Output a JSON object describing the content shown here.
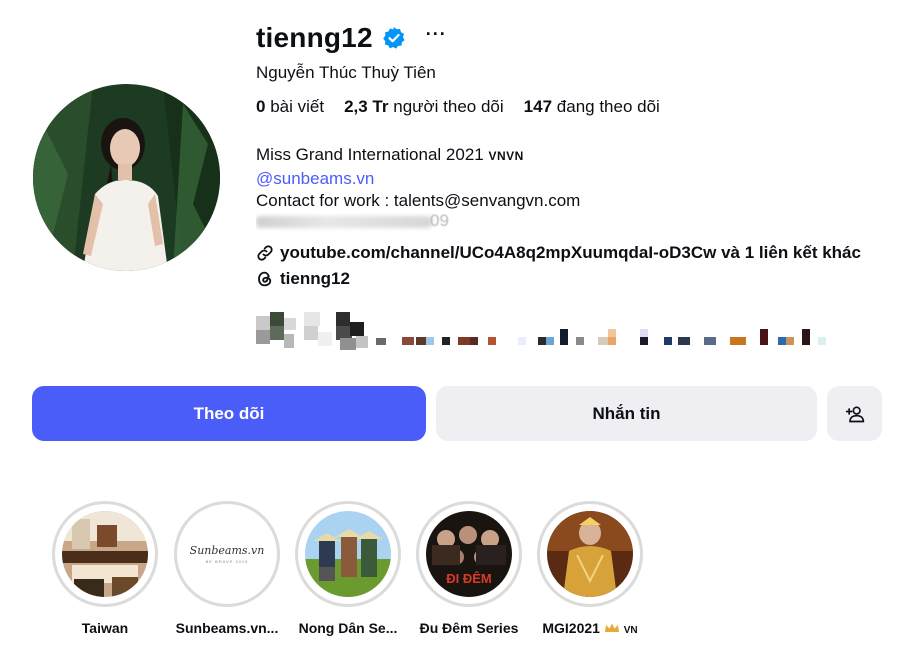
{
  "profile": {
    "username": "tienng12",
    "more_label": "···",
    "full_name": "Nguyễn Thúc Thuỳ Tiên",
    "stats": {
      "posts_value": "0",
      "posts_label": "bài viết",
      "followers_value": "2,3 Tr",
      "followers_label": "người theo dõi",
      "following_value": "147",
      "following_label": "đang theo dõi"
    },
    "bio": {
      "line1": "Miss Grand International 2021",
      "line1_suffix": "VNVN",
      "mention": "@sunbeams.vn",
      "contact": "Contact for work : talents@senvangvn.com",
      "phone_partial": "09"
    },
    "link": "youtube.com/channel/UCo4A8q2mpXuumqdaI-oD3Cw và 1 liên kết khác",
    "threads": "tienng12"
  },
  "actions": {
    "follow": "Theo dõi",
    "message": "Nhắn tin"
  },
  "highlights": [
    {
      "label": "Taiwan"
    },
    {
      "label": "Sunbeams.vn..."
    },
    {
      "label": "Nong Dân Se..."
    },
    {
      "label": "Đu Đêm Series"
    },
    {
      "label": "MGI2021",
      "suffix": "VN"
    }
  ],
  "highlight_texts": {
    "sunbeams_logo": "Sunbeams.vn",
    "sunbeams_sub": "BE BRAVE 2019",
    "dudem_title": "ĐI ĐÊM"
  },
  "colors": {
    "accent": "#4a5df9",
    "verified": "#0095f6",
    "button_secondary": "#efeff3",
    "ring": "#dbdbdb"
  },
  "icons": {
    "verified": "verified-badge-icon",
    "more": "more-horizontal-icon",
    "link": "link-icon",
    "threads": "threads-icon",
    "add_user": "add-user-icon"
  }
}
